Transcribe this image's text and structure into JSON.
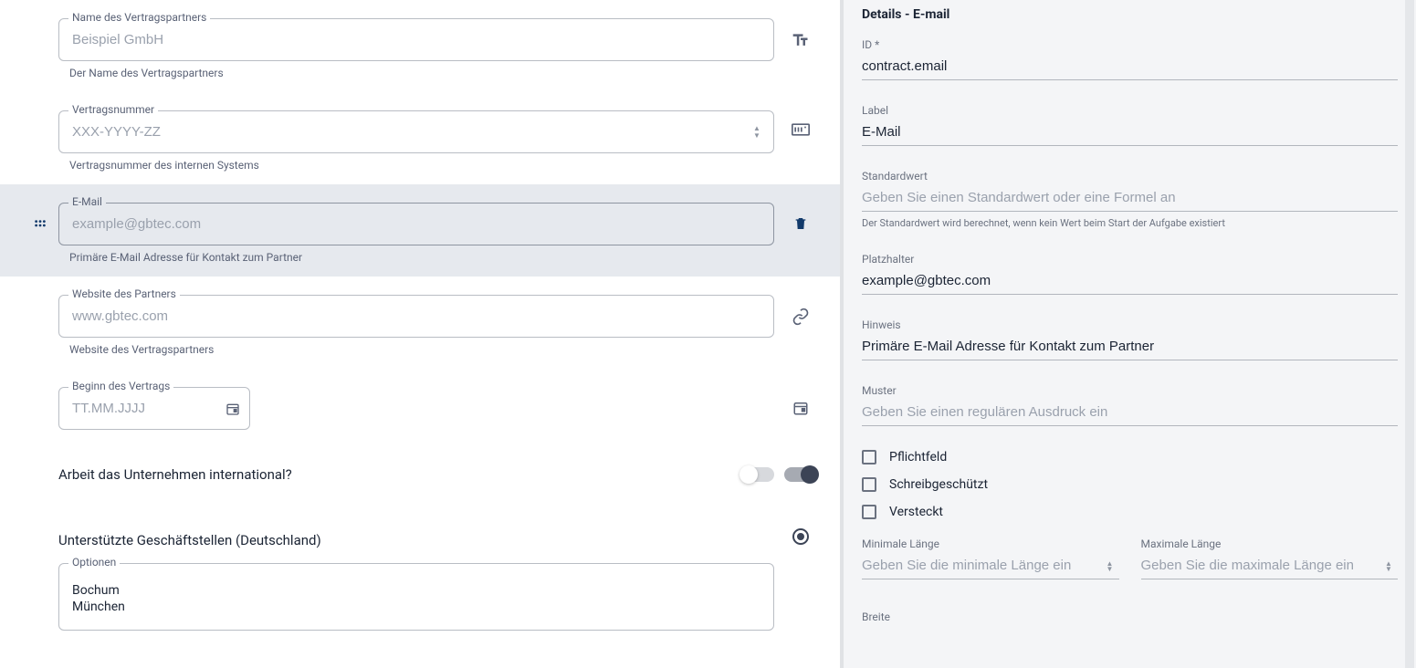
{
  "left": {
    "fields": [
      {
        "key": "partnerName",
        "label": "Name des Vertragspartners",
        "placeholder": "Beispiel GmbH",
        "helper": "Der Name des Vertragspartners",
        "icon": "text-size-icon"
      },
      {
        "key": "contractNumber",
        "label": "Vertragsnummer",
        "placeholder": "XXX-YYYY-ZZ",
        "helper": "Vertragsnummer des internen Systems",
        "icon": "number-panel-icon"
      },
      {
        "key": "email",
        "label": "E-Mail",
        "placeholder": "example@gbtec.com",
        "helper": "Primäre E-Mail Adresse für Kontakt zum Partner",
        "icon": "trash-icon"
      },
      {
        "key": "website",
        "label": "Website des Partners",
        "placeholder": "www.gbtec.com",
        "helper": "Website des Vertragspartners",
        "icon": "link-icon"
      },
      {
        "key": "startDate",
        "label": "Beginn des Vertrags",
        "placeholder": "TT.MM.JJJJ",
        "helper": "",
        "icon": "calendar-icon"
      }
    ],
    "intlQuestion": "Arbeit das Unternehmen international?",
    "offices": {
      "heading": "Unterstützte Geschäftstellen (Deutschland)",
      "optionsLabel": "Optionen",
      "options": [
        "Bochum",
        "München"
      ]
    }
  },
  "right": {
    "title": "Details - E-mail",
    "id": {
      "label": "ID *",
      "value": "contract.email"
    },
    "label": {
      "label": "Label",
      "value": "E-Mail"
    },
    "default": {
      "label": "Standardwert",
      "placeholder": "Geben Sie einen Standardwert oder eine Formel an",
      "helper": "Der Standardwert wird berechnet, wenn kein Wert beim Start der Aufgabe existiert"
    },
    "placeholder": {
      "label": "Platzhalter",
      "value": "example@gbtec.com"
    },
    "hint": {
      "label": "Hinweis",
      "value": "Primäre E-Mail Adresse für Kontakt zum Partner"
    },
    "pattern": {
      "label": "Muster",
      "placeholder": "Geben Sie einen regulären Ausdruck ein"
    },
    "checks": {
      "required": "Pflichtfeld",
      "readonly": "Schreibgeschützt",
      "hidden": "Versteckt"
    },
    "minLen": {
      "label": "Minimale Länge",
      "placeholder": "Geben Sie die minimale Länge ein"
    },
    "maxLen": {
      "label": "Maximale Länge",
      "placeholder": "Geben Sie die maximale Länge ein"
    },
    "width": {
      "label": "Breite"
    }
  }
}
